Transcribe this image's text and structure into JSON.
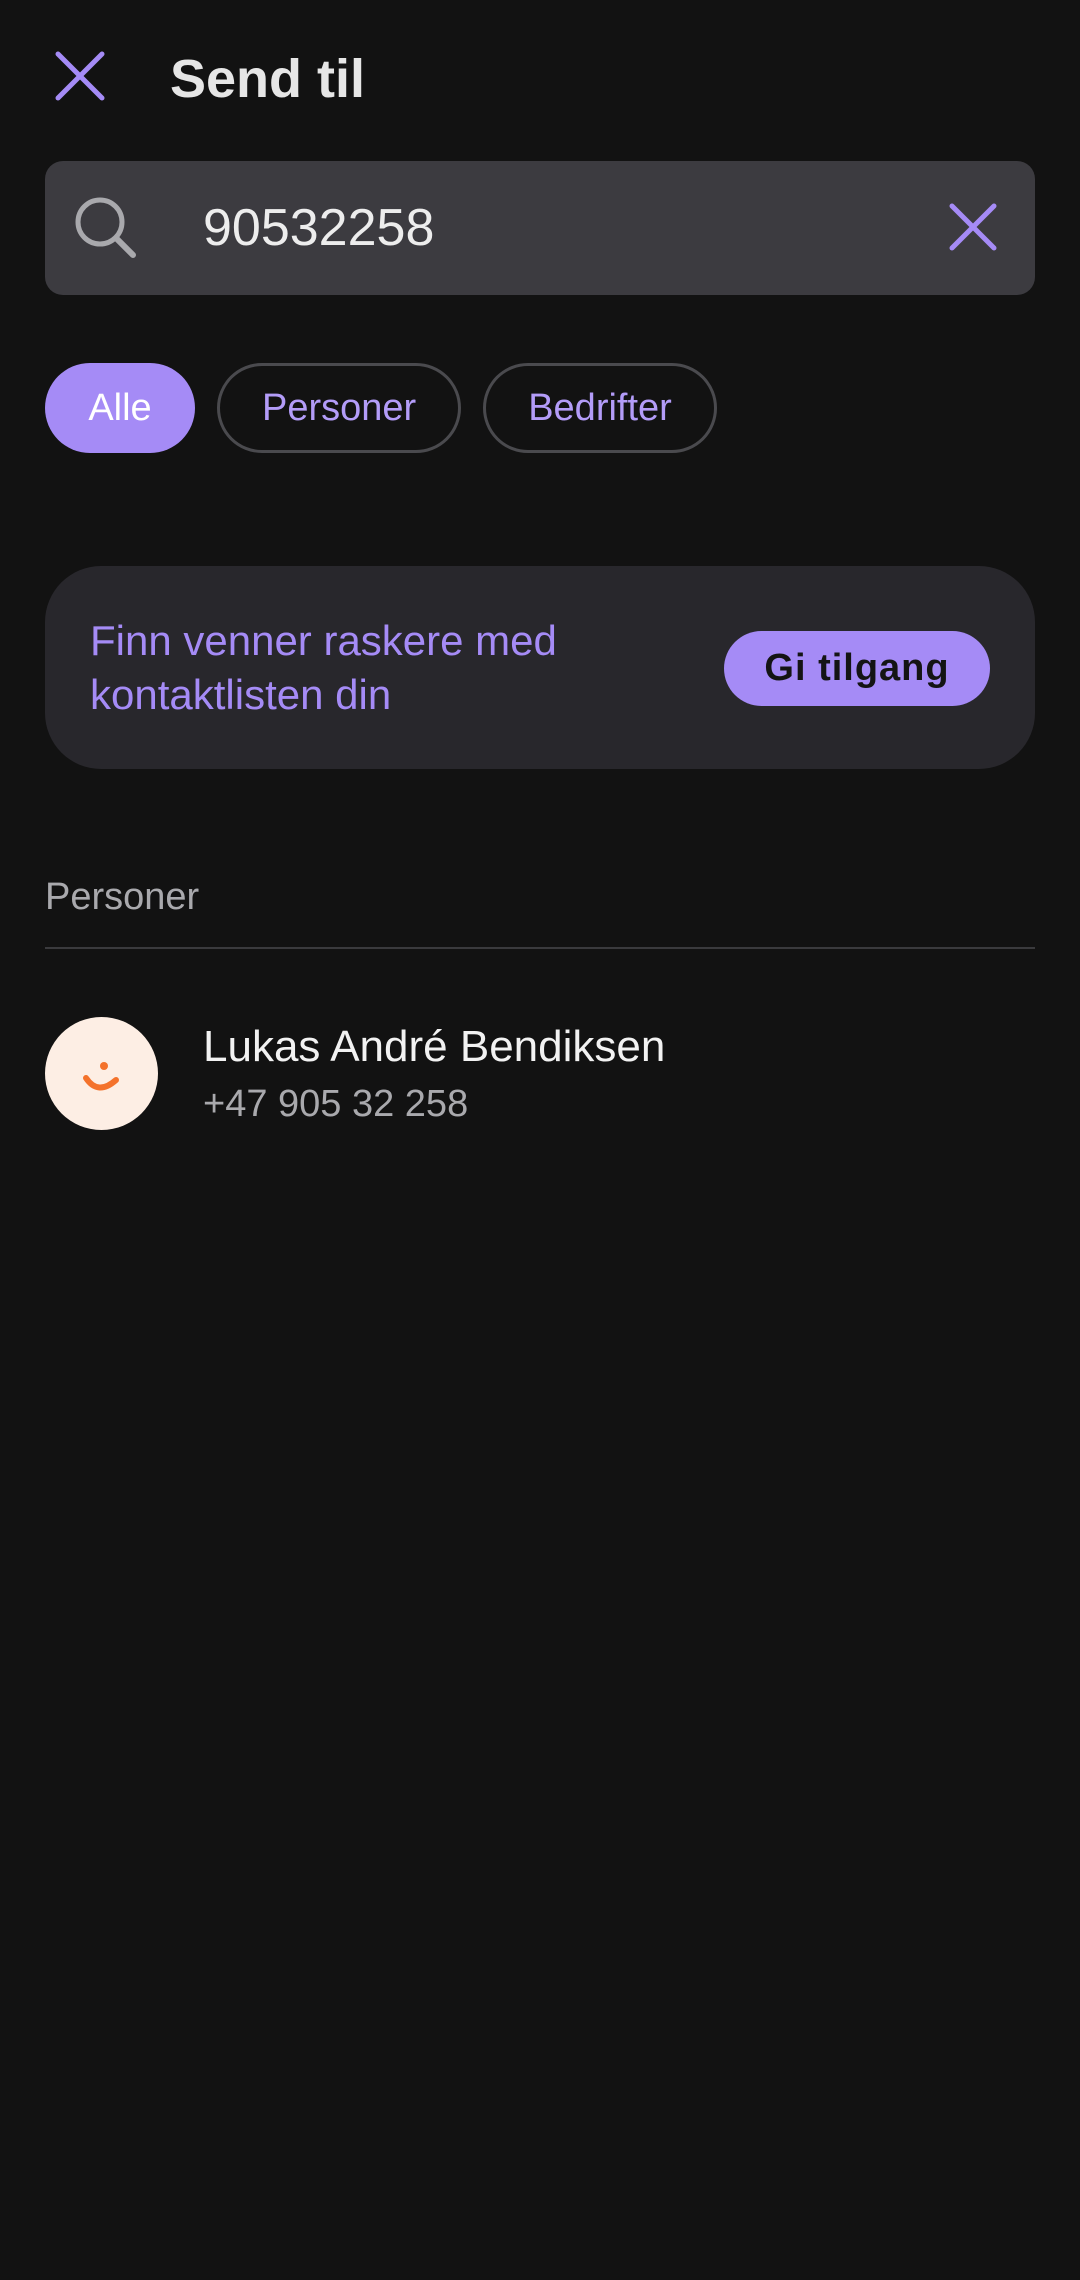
{
  "header": {
    "title": "Send til",
    "close_icon": "close-icon"
  },
  "search": {
    "value": "90532258",
    "icon": "search-icon",
    "clear_icon": "clear-icon"
  },
  "filters": [
    {
      "label": "Alle",
      "active": true
    },
    {
      "label": "Personer",
      "active": false
    },
    {
      "label": "Bedrifter",
      "active": false
    }
  ],
  "promo": {
    "text": "Finn venner raskere med kontaktlisten din",
    "button_label": "Gi tilgang"
  },
  "section": {
    "title": "Personer"
  },
  "contacts": [
    {
      "name": "Lukas André Bendiksen",
      "phone": "+47 905 32 258",
      "avatar_icon": "smiley-icon"
    }
  ],
  "colors": {
    "accent": "#a58bf6",
    "background": "#121212",
    "surface": "#28272c",
    "avatar_bg": "#fdeee4",
    "avatar_fg": "#f4722b"
  }
}
